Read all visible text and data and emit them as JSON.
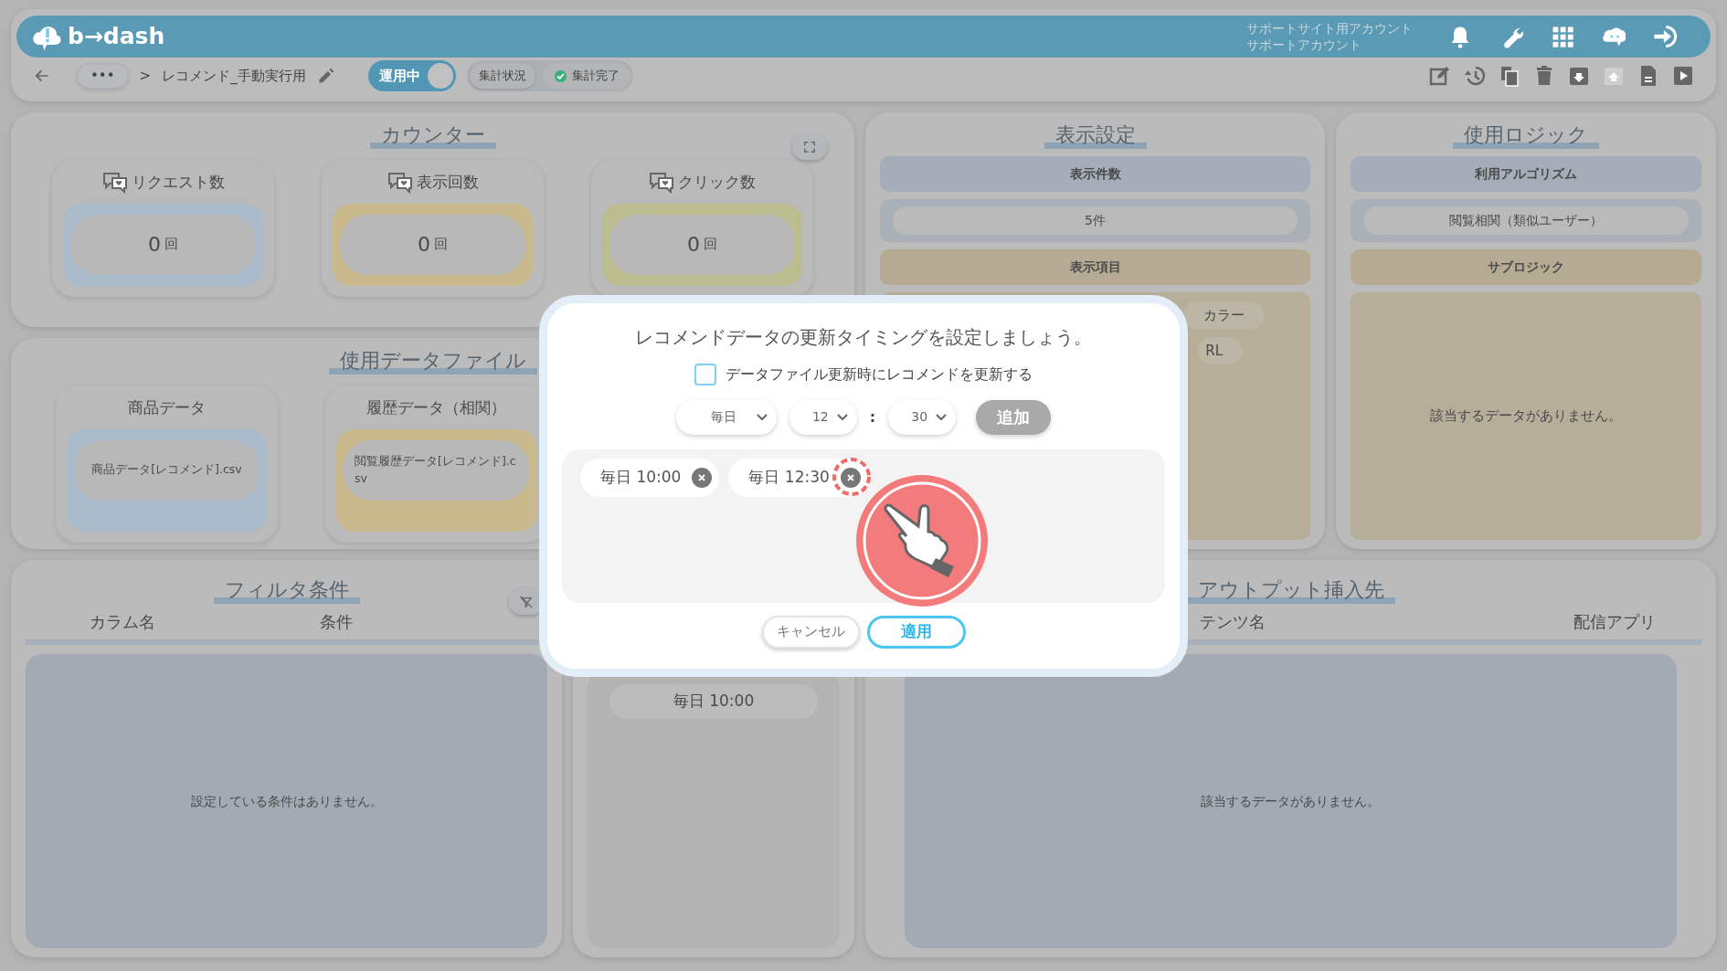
{
  "header": {
    "logo": "b→dash",
    "account_lines": [
      "サポートサイト用アカウント",
      "サポートアカウント"
    ],
    "icons": [
      {
        "kind": "bell"
      },
      {
        "kind": "wrench"
      },
      {
        "kind": "grid"
      },
      {
        "kind": "mascot"
      },
      {
        "kind": "signin"
      }
    ]
  },
  "toolbar": {
    "more": "•••",
    "separator": ">",
    "title": "レコメンド_手動実行用",
    "status_toggle": {
      "label": "運用中",
      "on": true
    },
    "aggregation": {
      "label": "集計状況",
      "status": "集計完了"
    },
    "actions": [
      {
        "kind": "edit",
        "disabled": false
      },
      {
        "kind": "history",
        "disabled": false
      },
      {
        "kind": "copy",
        "disabled": false
      },
      {
        "kind": "trash",
        "disabled": false
      },
      {
        "kind": "download",
        "disabled": false
      },
      {
        "kind": "upload",
        "disabled": true
      },
      {
        "kind": "document",
        "disabled": false
      },
      {
        "kind": "play",
        "disabled": false
      }
    ]
  },
  "counter": {
    "title": "カウンター",
    "cards": [
      {
        "label": "リクエスト数",
        "value": "0",
        "unit": "回",
        "color": "#a9bacb"
      },
      {
        "label": "表示回数",
        "value": "0",
        "unit": "回",
        "color": "#c9b98d"
      },
      {
        "label": "クリック数",
        "value": "0",
        "unit": "回",
        "color": "#bbbd8e"
      }
    ]
  },
  "data_files": {
    "title": "使用データファイル",
    "cards": [
      {
        "label": "商品データ",
        "file": "商品データ[レコメンド].csv",
        "color": "#a9bacb"
      },
      {
        "label": "履歴データ（相関）",
        "file": "閲覧履歴データ[レコメンド].csv",
        "color": "#c9b98d"
      }
    ]
  },
  "display_settings": {
    "title": "表示設定",
    "count_label": "表示件数",
    "count": "5件",
    "items_label": "表示項目",
    "items": [
      "カラー",
      "RL"
    ]
  },
  "logic": {
    "title": "使用ロジック",
    "algorithm_label": "利用アルゴリズム",
    "algorithm": "閲覧相関（類似ユーザー）",
    "sub_label": "サブロジック",
    "empty": "該当するデータがありません。"
  },
  "filter": {
    "title": "フィルタ条件",
    "columns": [
      "カラム名",
      "条件"
    ],
    "empty": "設定している条件はありません。"
  },
  "schedule": {
    "entries": [
      "毎日 10:00"
    ]
  },
  "output": {
    "title": "アウトプット挿入先",
    "columns": [
      "テンツ名",
      "配信アプリ"
    ],
    "empty": "該当するデータがありません。"
  },
  "modal": {
    "title": "レコメンドデータの更新タイミングを設定しましょう。",
    "checkbox": {
      "label": "データファイル更新時にレコメンドを更新する",
      "checked": false
    },
    "frequency": "毎日",
    "hour": "12",
    "separator": ":",
    "minute": "30",
    "add_button": {
      "label": "追加",
      "disabled": true
    },
    "entries": [
      {
        "label": "毎日 10:00",
        "highlighted": false
      },
      {
        "label": "毎日 12:30",
        "highlighted": true
      }
    ],
    "cancel": "キャンセル",
    "apply": "適用"
  }
}
